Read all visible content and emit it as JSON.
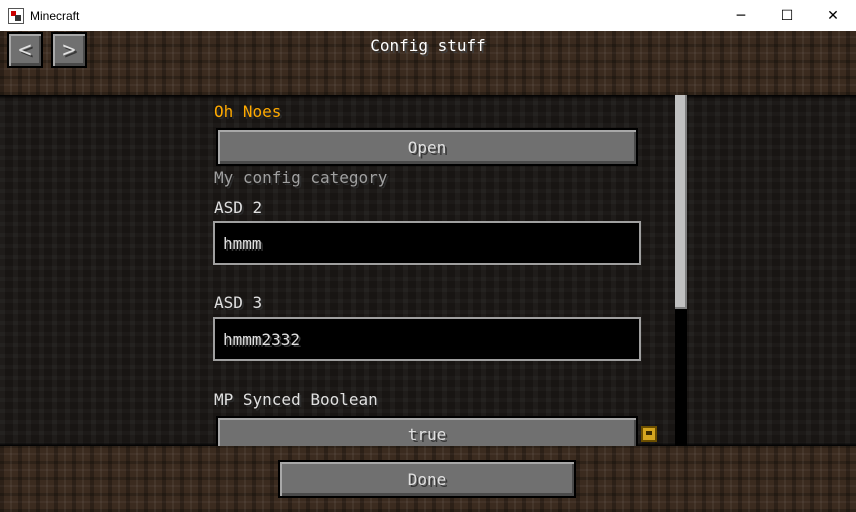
{
  "window": {
    "title": "Minecraft",
    "minimize_symbol": "─",
    "maximize_symbol": "☐",
    "close_symbol": "✕"
  },
  "header": {
    "title": "Config stuff",
    "back_symbol": "<",
    "forward_symbol": ">"
  },
  "config": {
    "category_oh_noes": "Oh Noes",
    "open_button": "Open",
    "category_my_config": "My config category",
    "entries": [
      {
        "label": "ASD 2",
        "value": "hmmm"
      },
      {
        "label": "ASD 3",
        "value": "hmmm2332"
      }
    ],
    "mp_synced": {
      "label": "MP Synced Boolean",
      "value": "true"
    }
  },
  "footer": {
    "done_button": "Done"
  },
  "colors": {
    "category_highlight": "#ffaa00",
    "category_muted": "#a0a0a0",
    "label": "#e0e0e0"
  },
  "scroll": {
    "visible_fraction": 0.61
  }
}
